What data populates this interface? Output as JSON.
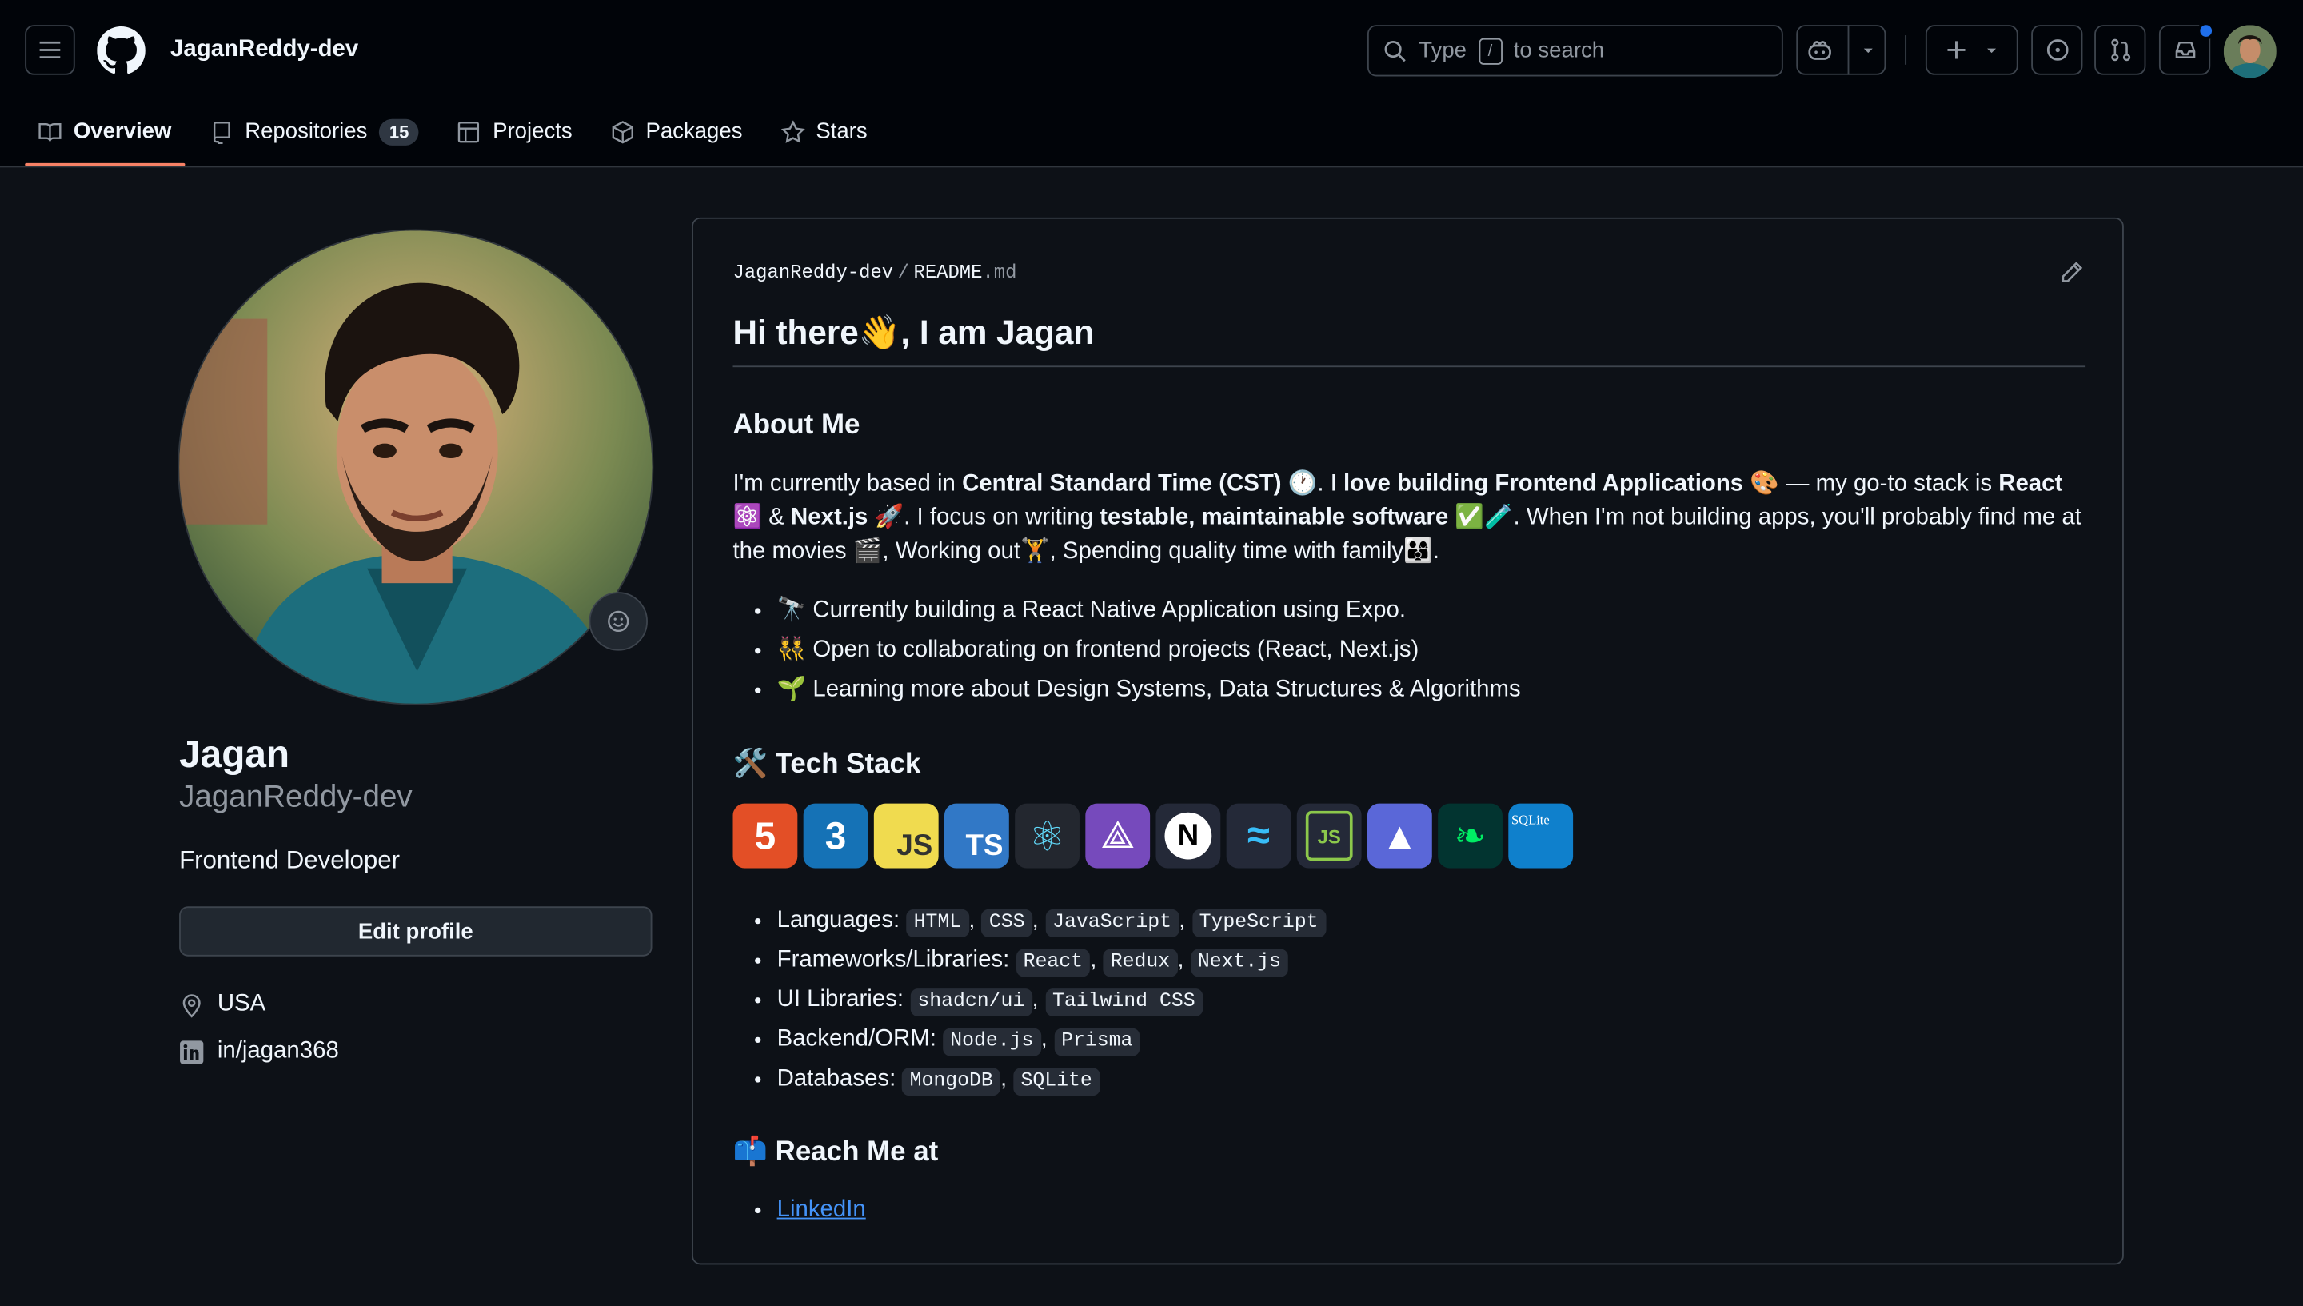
{
  "header": {
    "username": "JaganReddy-dev",
    "search_prefix": "Type",
    "search_key": "/",
    "search_suffix": "to search"
  },
  "tabs": [
    {
      "label": "Overview"
    },
    {
      "label": "Repositories",
      "count": "15"
    },
    {
      "label": "Projects"
    },
    {
      "label": "Packages"
    },
    {
      "label": "Stars"
    }
  ],
  "profile": {
    "name": "Jagan",
    "login": "JaganReddy-dev",
    "bio": "Frontend Developer",
    "edit_label": "Edit profile",
    "location": "USA",
    "linkedin": "in/jagan368"
  },
  "readme": {
    "path_owner": "JaganReddy-dev",
    "path_sep": "/",
    "path_file": "README",
    "path_ext": ".md",
    "title": "Hi there👋, I am Jagan",
    "about_heading": "About Me",
    "about_p1": "I'm currently based in ",
    "about_b1": "Central Standard Time (CST)",
    "about_p2": " 🕐. I ",
    "about_b2": "love building Frontend Applications",
    "about_p3": " 🎨 — my go-to stack is ",
    "about_b3": "React",
    "about_p4": " ⚛️ & ",
    "about_b4": "Next.js",
    "about_p5": " 🚀. I focus on writing ",
    "about_b5": "testable, maintainable software",
    "about_p6": " ✅🧪. When I'm not building apps, you'll probably find me at the movies 🎬, Working out🏋️, Spending quality time with family👨‍👩‍👦.",
    "bullets": [
      "🔭 Currently building a React Native Application using Expo.",
      "👯 Open to collaborating on frontend projects (React, Next.js)",
      "🌱 Learning more about Design Systems, Data Structures & Algorithms"
    ],
    "tech_heading": "🛠️ Tech Stack",
    "badges": [
      {
        "label": "5",
        "icon": "html5-icon",
        "color": "#e34f26"
      },
      {
        "label": "3",
        "icon": "css3-icon",
        "color": "#1572b6"
      },
      {
        "label": "JS",
        "icon": "javascript-icon",
        "color": "#f0db4f"
      },
      {
        "label": "TS",
        "icon": "typescript-icon",
        "color": "#3178c6"
      },
      {
        "label": "⚛",
        "icon": "react-icon",
        "color": "#23272f"
      },
      {
        "label": "⟁",
        "icon": "redux-icon",
        "color": "#764abc"
      },
      {
        "label": "N",
        "icon": "nextjs-icon",
        "color": "#242938"
      },
      {
        "label": "≈",
        "icon": "tailwind-icon",
        "color": "#242938"
      },
      {
        "label": "JS",
        "icon": "nodejs-icon",
        "color": "#242938"
      },
      {
        "label": "▲",
        "icon": "prisma-icon",
        "color": "#5a67d8"
      },
      {
        "label": "❧",
        "icon": "mongodb-icon",
        "color": "#023430"
      },
      {
        "label": "SQLite",
        "icon": "sqlite-icon",
        "color": "#0f80cc"
      }
    ],
    "stack": [
      {
        "label": "Languages:",
        "items": [
          "HTML",
          "CSS",
          "JavaScript",
          "TypeScript"
        ]
      },
      {
        "label": "Frameworks/Libraries:",
        "items": [
          "React",
          "Redux",
          "Next.js"
        ]
      },
      {
        "label": "UI Libraries:",
        "items": [
          "shadcn/ui",
          "Tailwind CSS"
        ]
      },
      {
        "label": "Backend/ORM:",
        "items": [
          "Node.js",
          "Prisma"
        ]
      },
      {
        "label": "Databases:",
        "items": [
          "MongoDB",
          "SQLite"
        ]
      }
    ],
    "reach_heading": "📫 Reach Me at",
    "reach_link": "LinkedIn"
  }
}
